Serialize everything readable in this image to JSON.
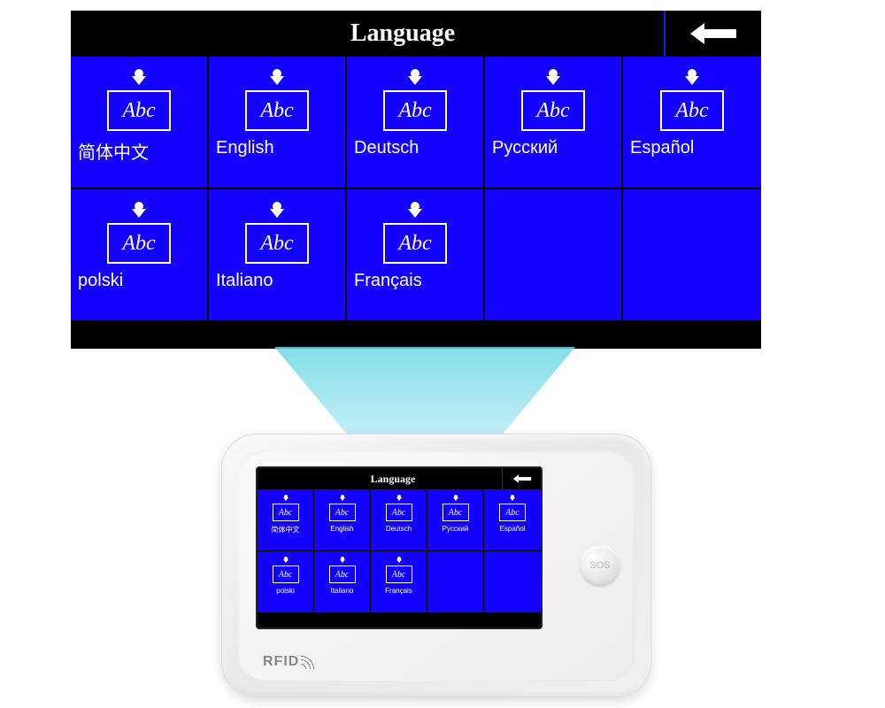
{
  "header": {
    "title": "Language",
    "back_icon": "arrow-left"
  },
  "icon_text": "Abc",
  "languages": [
    {
      "label": "简体中文"
    },
    {
      "label": "English"
    },
    {
      "label": "Deutsch"
    },
    {
      "label": "Русский"
    },
    {
      "label": "Español"
    },
    {
      "label": "polski"
    },
    {
      "label": "Italiano"
    },
    {
      "label": "Français"
    }
  ],
  "device": {
    "sos_label": "SOS",
    "rfid_label": "RFID"
  }
}
